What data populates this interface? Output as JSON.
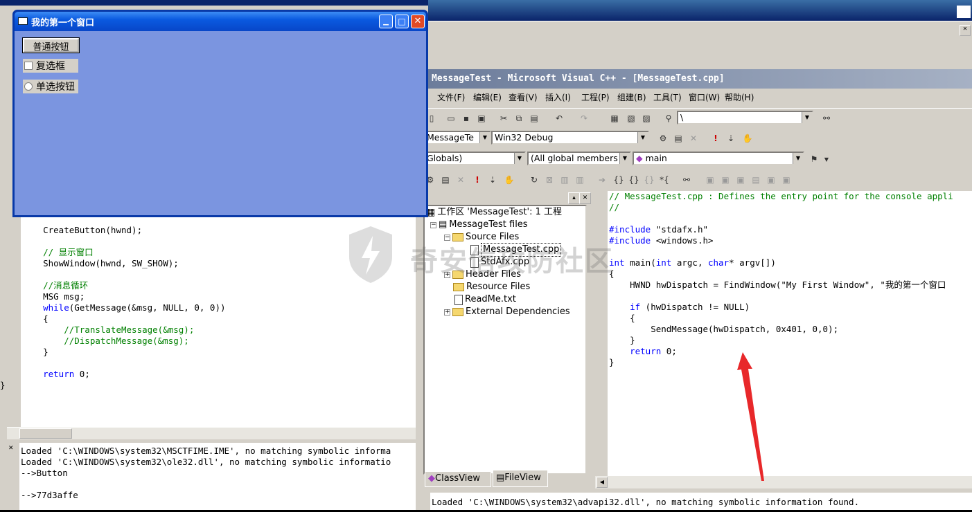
{
  "bg_window": {
    "title": "MessageTest - Microsoft Visual C++ - [MessageTest.cpp]"
  },
  "menu": [
    "文件(F)",
    "编辑(E)",
    "查看(V)",
    "插入(I)",
    "工程(P)",
    "组建(B)",
    "工具(T)",
    "窗口(W)",
    "帮助(H)"
  ],
  "toolbar": {
    "find_combo": "\\",
    "project_combo": "MessageTe",
    "config_combo": "Win32 Debug",
    "scope_combo": "Globals)",
    "members_combo": "(All global members",
    "func_combo": "main"
  },
  "workspace": {
    "title": "工作区 'MessageTest': 1 工程",
    "project": "MessageTest files",
    "source": "Source Files",
    "file1": "MessageTest.cpp",
    "file2": "StdAfx.cpp",
    "header": "Header Files",
    "resource": "Resource Files",
    "readme": "ReadMe.txt",
    "external": "External Dependencies",
    "tab_class": "ClassView",
    "tab_file": "FileView"
  },
  "right_code": {
    "l1": "// MessageTest.cpp : Defines the entry point for the console appli",
    "l2": "//",
    "inc1a": "#include",
    "inc1b": " \"stdafx.h\"",
    "inc2a": "#include",
    "inc2b": " <windows.h>",
    "main_a": "int",
    "main_b": " main(",
    "main_c": "int",
    "main_d": " argc, ",
    "main_e": "char",
    "main_f": "* argv[])",
    "brace1": "{",
    "hw": "    HWND hwDispatch = FindWindow(\"My First Window\", \"我的第一个窗口",
    "if_a": "    if",
    "if_b": " (hwDispatch != NULL)",
    "brace2": "    {",
    "send": "        SendMessage(hwDispatch, 0x401, 0,0);",
    "brace3": "    }",
    "ret_a": "    return",
    "ret_b": " 0;",
    "brace4": "}"
  },
  "left_code": {
    "c1": "    CreateButton(hwnd);",
    "c2": "    // 显示窗口",
    "c3": "    ShowWindow(hwnd, SW_SHOW);",
    "c4": "    //消息循环",
    "c5": "    MSG msg;",
    "c6a": "    while",
    "c6b": "(GetMessage(&msg, NULL, 0, 0))",
    "c7": "    {",
    "c8": "        //TranslateMessage(&msg);",
    "c9": "        //DispatchMessage(&msg);",
    "c10": "    }",
    "c11a": "    return",
    "c11b": " 0;",
    "c12": "}"
  },
  "left_output": {
    "o1": "Loaded 'C:\\WINDOWS\\system32\\MSCTFIME.IME', no matching symbolic informa",
    "o2": "Loaded 'C:\\WINDOWS\\system32\\ole32.dll', no matching symbolic informatio",
    "o3": "-->Button",
    "o4": "-->77d3affe"
  },
  "right_output": {
    "o1": "Loaded 'C:\\WINDOWS\\system32\\advapi32.dll', no matching symbolic information found."
  },
  "app_window": {
    "title": "我的第一个窗口",
    "button": "普通按钮",
    "checkbox": "复选框",
    "radio": "单选按钮"
  },
  "watermark": "奇安信攻防社区"
}
